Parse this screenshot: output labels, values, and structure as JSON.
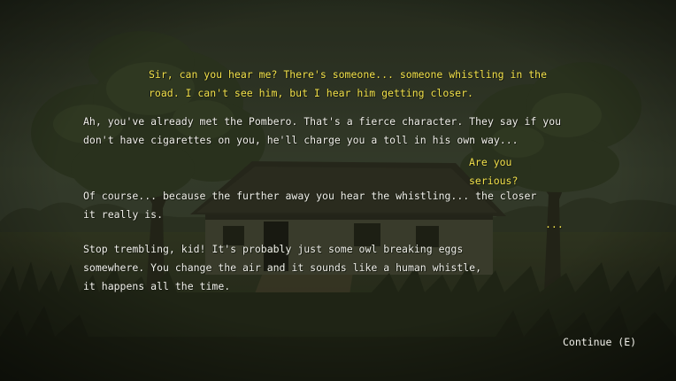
{
  "dialogue": {
    "lines": [
      {
        "speaker": "player",
        "text": "Sir, can you hear me? There's someone... someone whistling in the road. I can't see him, but I hear him getting closer."
      },
      {
        "speaker": "npc",
        "text": "Ah, you've already met the Pombero. That's a fierce character. They say if you don't have cigarettes on you, he'll charge you a toll in his own way..."
      },
      {
        "speaker": "player",
        "text": "Are you serious?"
      },
      {
        "speaker": "npc",
        "text": "Of course... because the further away you hear the whistling... the closer it really is."
      },
      {
        "speaker": "player",
        "text": "..."
      },
      {
        "speaker": "npc",
        "text": "Stop trembling, kid! It's probably just some owl breaking eggs somewhere. You change the air and it sounds like a human whistle, it happens all the time."
      }
    ]
  },
  "controls": {
    "continue_label": "Continue (E)"
  },
  "colors": {
    "player_text": "#f2e14a",
    "npc_text": "#f1f0ea",
    "sky": "#3f4734",
    "grass": "#2c3120"
  }
}
